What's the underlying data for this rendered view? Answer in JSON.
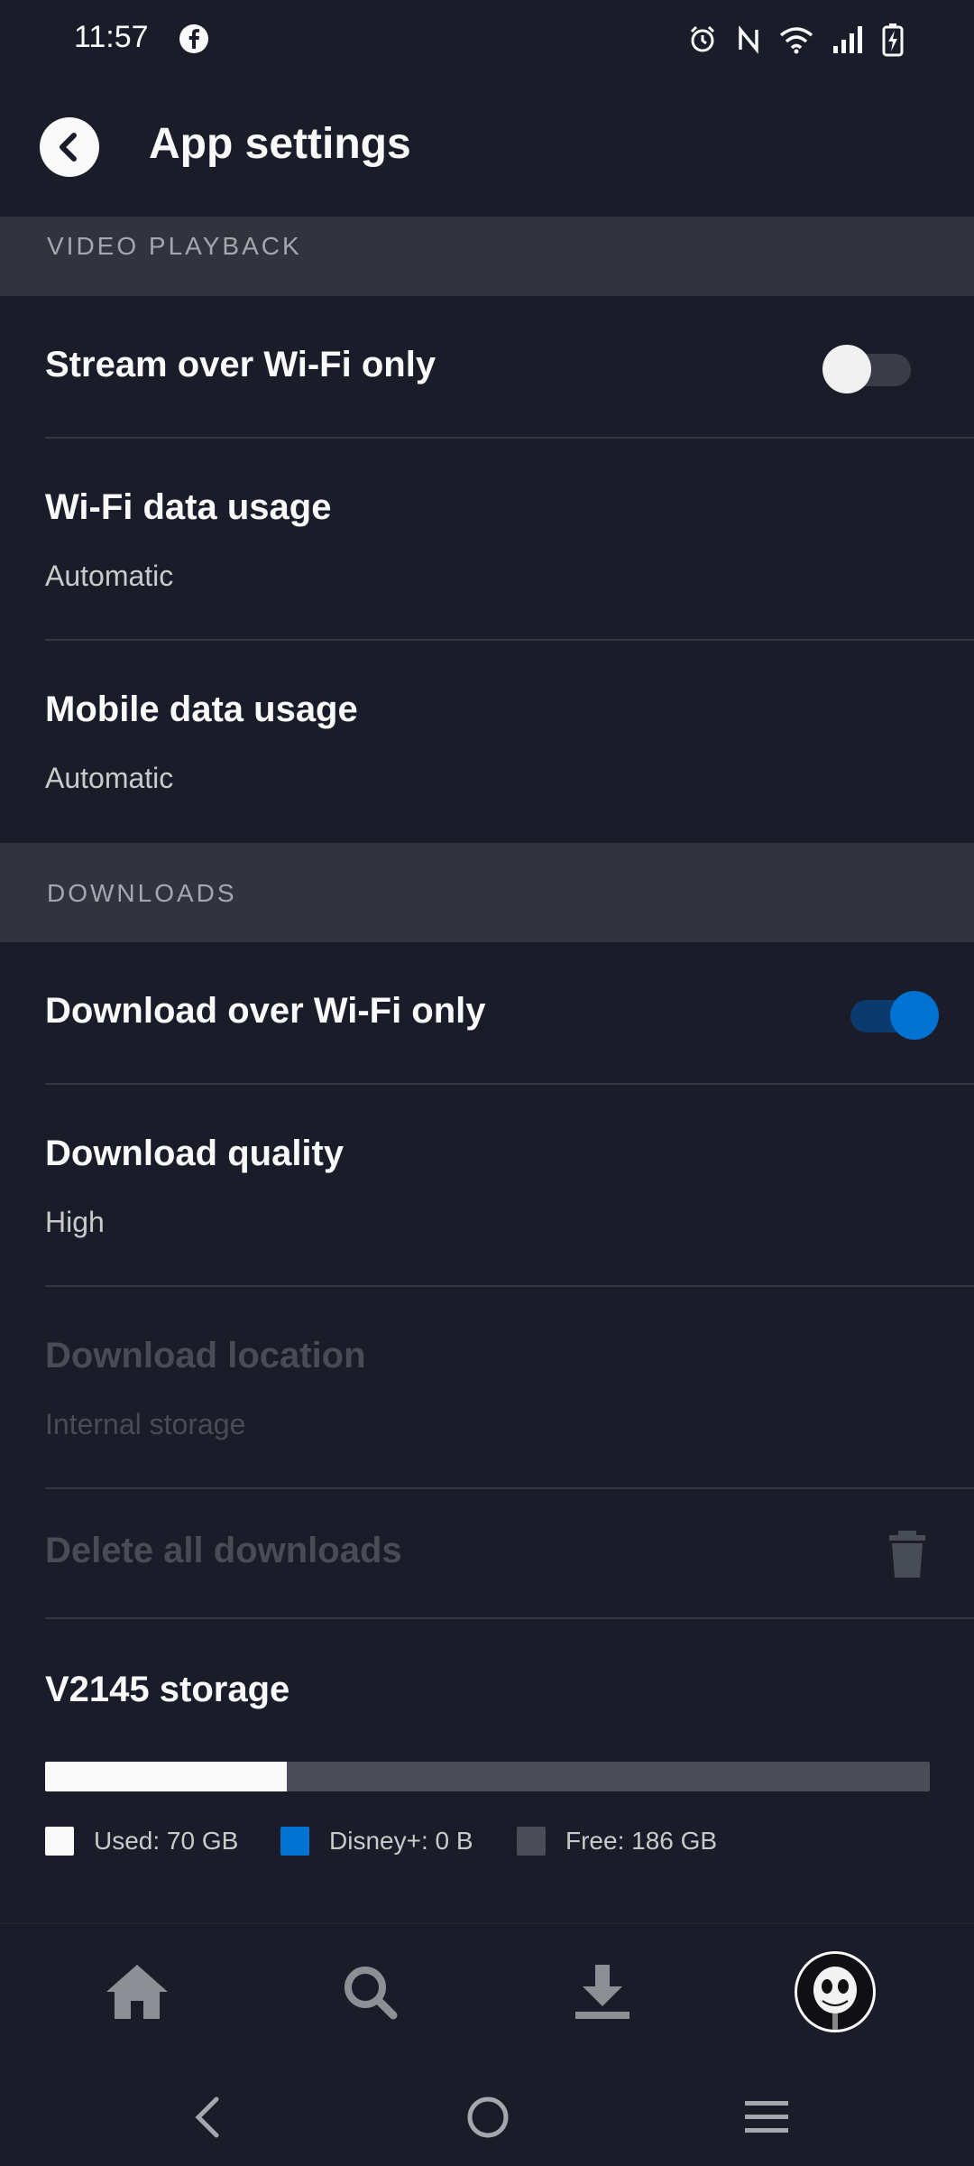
{
  "status_bar": {
    "time": "11:57",
    "icons": [
      "facebook-icon",
      "alarm-icon",
      "nfc-icon",
      "wifi-icon",
      "signal-icon",
      "battery-charging-icon"
    ]
  },
  "header": {
    "title": "App settings",
    "back_icon": "chevron-left-icon"
  },
  "video_playback": {
    "section_label": "VIDEO PLAYBACK",
    "stream_wifi": {
      "label": "Stream over Wi-Fi only",
      "enabled": false
    },
    "wifi_usage": {
      "label": "Wi-Fi data usage",
      "value": "Automatic"
    },
    "mobile_usage": {
      "label": "Mobile data usage",
      "value": "Automatic"
    }
  },
  "downloads": {
    "section_label": "DOWNLOADS",
    "download_wifi": {
      "label": "Download over Wi-Fi only",
      "enabled": true
    },
    "quality": {
      "label": "Download quality",
      "value": "High"
    },
    "location": {
      "label": "Download location",
      "value": "Internal storage",
      "disabled": true
    },
    "delete_all": {
      "label": "Delete all downloads",
      "icon": "trash-icon",
      "disabled": true
    }
  },
  "storage": {
    "title": "V2145 storage",
    "used_fraction": 0.273,
    "legend": {
      "used": "Used: 70 GB",
      "disney": "Disney+: 0 B",
      "free": "Free: 186 GB"
    }
  },
  "bottom_nav": {
    "items": [
      "home-icon",
      "search-icon",
      "downloads-icon",
      "profile-avatar"
    ]
  },
  "colors": {
    "background": "#1a1d29",
    "section": "#31343e",
    "accent": "#0072d2",
    "used": "#f9f9f9",
    "free": "#4a4d57"
  }
}
